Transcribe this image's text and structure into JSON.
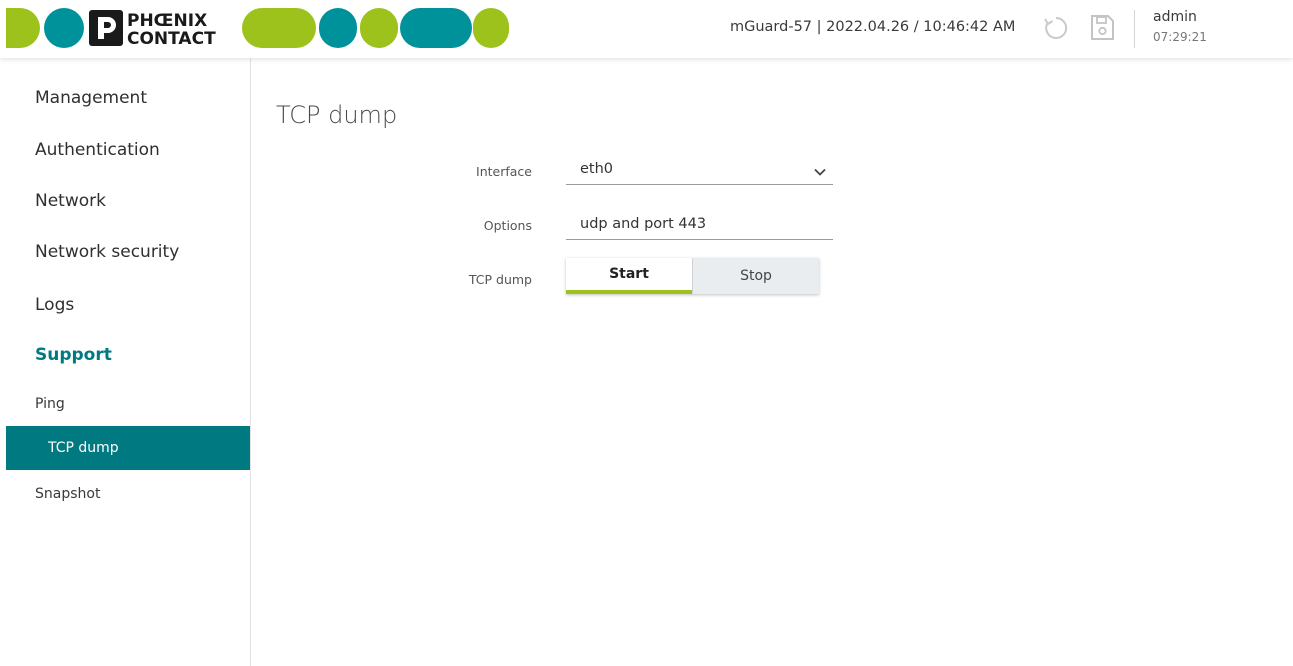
{
  "header": {
    "device_info": "mGuard-57 | 2022.04.26 / 10:46:42 AM",
    "user_name": "admin",
    "user_time": "07:29:21",
    "logo_text": "PHOENIX CONTACT"
  },
  "colors": {
    "brand_green": "#9dc21b",
    "brand_teal": "#00929a",
    "accent": "#007a80"
  },
  "icons": {
    "refresh": "refresh-icon",
    "save": "save-icon",
    "chevron": "chevron-down-icon"
  },
  "sidebar": {
    "items": [
      {
        "label": "Management"
      },
      {
        "label": "Authentication"
      },
      {
        "label": "Network"
      },
      {
        "label": "Network security"
      },
      {
        "label": "Logs"
      },
      {
        "label": "Support"
      },
      {
        "label": "Ping"
      },
      {
        "label": "TCP dump"
      },
      {
        "label": "Snapshot"
      }
    ]
  },
  "main": {
    "title": "TCP dump",
    "form": {
      "interface_label": "Interface",
      "interface_value": "eth0",
      "options_label": "Options",
      "options_value": "udp and port 443",
      "tcpdump_label": "TCP dump",
      "start_label": "Start",
      "stop_label": "Stop"
    }
  }
}
